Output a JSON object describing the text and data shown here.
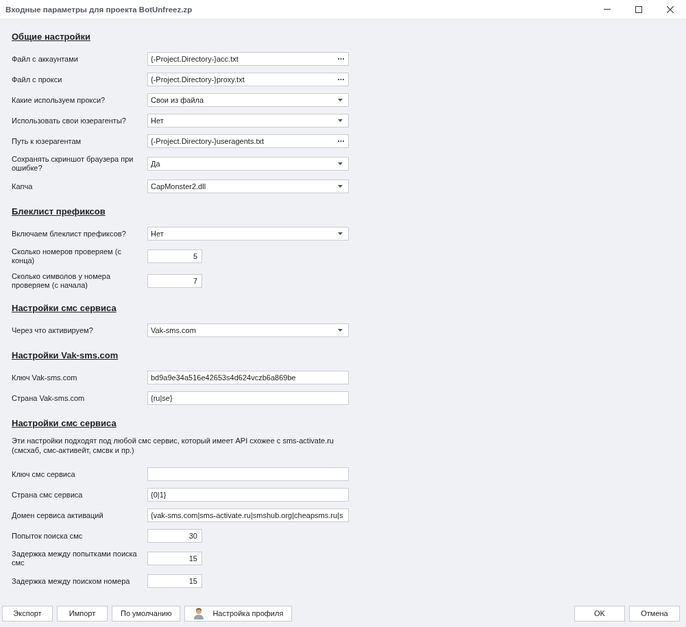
{
  "window": {
    "title": "Входные параметры для проекта BotUnfreez.zp"
  },
  "sections": [
    {
      "title": "Общие настройки",
      "items": [
        {
          "kind": "file",
          "label": "Файл с аккаунтами",
          "value": "{-Project.Directory-}acc.txt"
        },
        {
          "kind": "file",
          "label": "Файл с прокси",
          "value": "{-Project.Directory-}proxy.txt"
        },
        {
          "kind": "dropdown",
          "label": "Какие используем прокси?",
          "value": "Свои из файла"
        },
        {
          "kind": "dropdown",
          "label": "Использовать свои юзерагенты?",
          "value": "Нет"
        },
        {
          "kind": "file",
          "label": "Путь к юзерагентам",
          "value": "{-Project.Directory-}useragents.txt"
        },
        {
          "kind": "dropdown",
          "label": "Сохранять скриншот браузера при ошибке?",
          "value": "Да"
        },
        {
          "kind": "dropdown",
          "label": "Капча",
          "value": "CapMonster2.dll"
        }
      ]
    },
    {
      "title": "Блеклист префиксов",
      "items": [
        {
          "kind": "dropdown",
          "label": "Включаем блеклист префиксов?",
          "value": "Нет"
        },
        {
          "kind": "number",
          "label": "Сколько номеров проверяем (с конца)",
          "value": "5"
        },
        {
          "kind": "number",
          "label": "Сколько символов у номера проверяем (с начала)",
          "value": "7"
        }
      ]
    },
    {
      "title": "Настройки смс сервиса",
      "items": [
        {
          "kind": "dropdown",
          "label": "Через что активируем?",
          "value": "Vak-sms.com"
        }
      ]
    },
    {
      "title": "Настройки Vak-sms.com",
      "items": [
        {
          "kind": "text",
          "label": "Ключ Vak-sms.com",
          "value": "bd9a9e34a516e42653s4d624vczb6a869be"
        },
        {
          "kind": "text",
          "label": "Страна Vak-sms.com",
          "value": "{ru|se}"
        }
      ]
    },
    {
      "title": "Настройки смс сервиса",
      "items": [
        {
          "kind": "note",
          "text": "Эти настройки подходят под любой смс сервис, который имеет API схожее с sms-activate.ru (смсхаб, смс-активейт, смсвк и пр.)"
        },
        {
          "kind": "text",
          "label": "Ключ смс сервиса"
        },
        {
          "kind": "text",
          "label": "Страна смс сервиса",
          "value": "{0|1}"
        },
        {
          "kind": "text",
          "label": "Домен сервиса активаций",
          "value": "{vak-sms.com|sms-activate.ru|smshub.org|cheapsms.ru|s"
        },
        {
          "kind": "number",
          "label": "Попыток поиска смс",
          "value": "30"
        },
        {
          "kind": "number",
          "label": "Задержка между попытками поиска смс",
          "value": "15"
        },
        {
          "kind": "number",
          "label": "Задержка между поиском номера",
          "value": "15"
        }
      ]
    }
  ],
  "footer": {
    "left_buttons": [
      {
        "kind": "plain",
        "label": "Экспорт"
      },
      {
        "kind": "plain",
        "label": "Импорт"
      },
      {
        "kind": "plain",
        "label": "По умолчанию"
      },
      {
        "kind": "profile",
        "label": "Настройка профиля"
      }
    ],
    "right_buttons": [
      {
        "label": "OK"
      },
      {
        "label": "Отмена"
      }
    ]
  }
}
